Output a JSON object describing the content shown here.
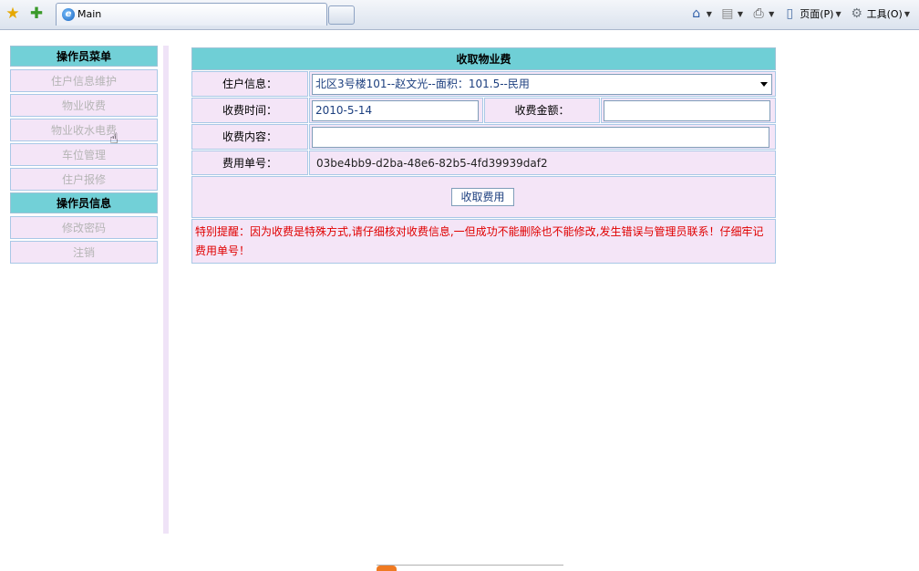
{
  "browser": {
    "tab_title": "Main",
    "page_menu": "页面(P)",
    "tools_menu": "工具(O)",
    "icons": [
      "favorites-star-icon",
      "add-favorite-icon",
      "ie-icon",
      "home-icon",
      "feed-icon",
      "print-icon",
      "page-icon",
      "gear-icon"
    ]
  },
  "sidebar": {
    "section1_title": "操作员菜单",
    "section1_items": [
      "住户信息维护",
      "物业收费",
      "物业收水电费",
      "车位管理",
      "住户报修"
    ],
    "section2_title": "操作员信息",
    "section2_items": [
      "修改密码",
      "注销"
    ]
  },
  "form": {
    "title": "收取物业费",
    "resident_label": "住户信息：",
    "resident_value": "北区3号楼101--赵文光--面积：101.5--民用",
    "time_label": "收费时间：",
    "time_value": "2010-5-14",
    "amount_label": "收费金额：",
    "amount_value": "",
    "content_label": "收费内容：",
    "content_value": "",
    "bill_label": "费用单号：",
    "bill_value": "03be4bb9-d2ba-48e6-82b5-4fd39939daf2",
    "submit_label": "收取费用",
    "notice": "特别提醒：因为收费是特殊方式,请仔细核对收费信息,一但成功不能删除也不能修改,发生错误与管理员联系！仔细牢记费用单号！"
  },
  "colors": {
    "header_teal": "#72d0d7",
    "cell_pink": "#f4e5f7",
    "border_blue": "#a9c8e6",
    "notice_red": "#e00000"
  }
}
